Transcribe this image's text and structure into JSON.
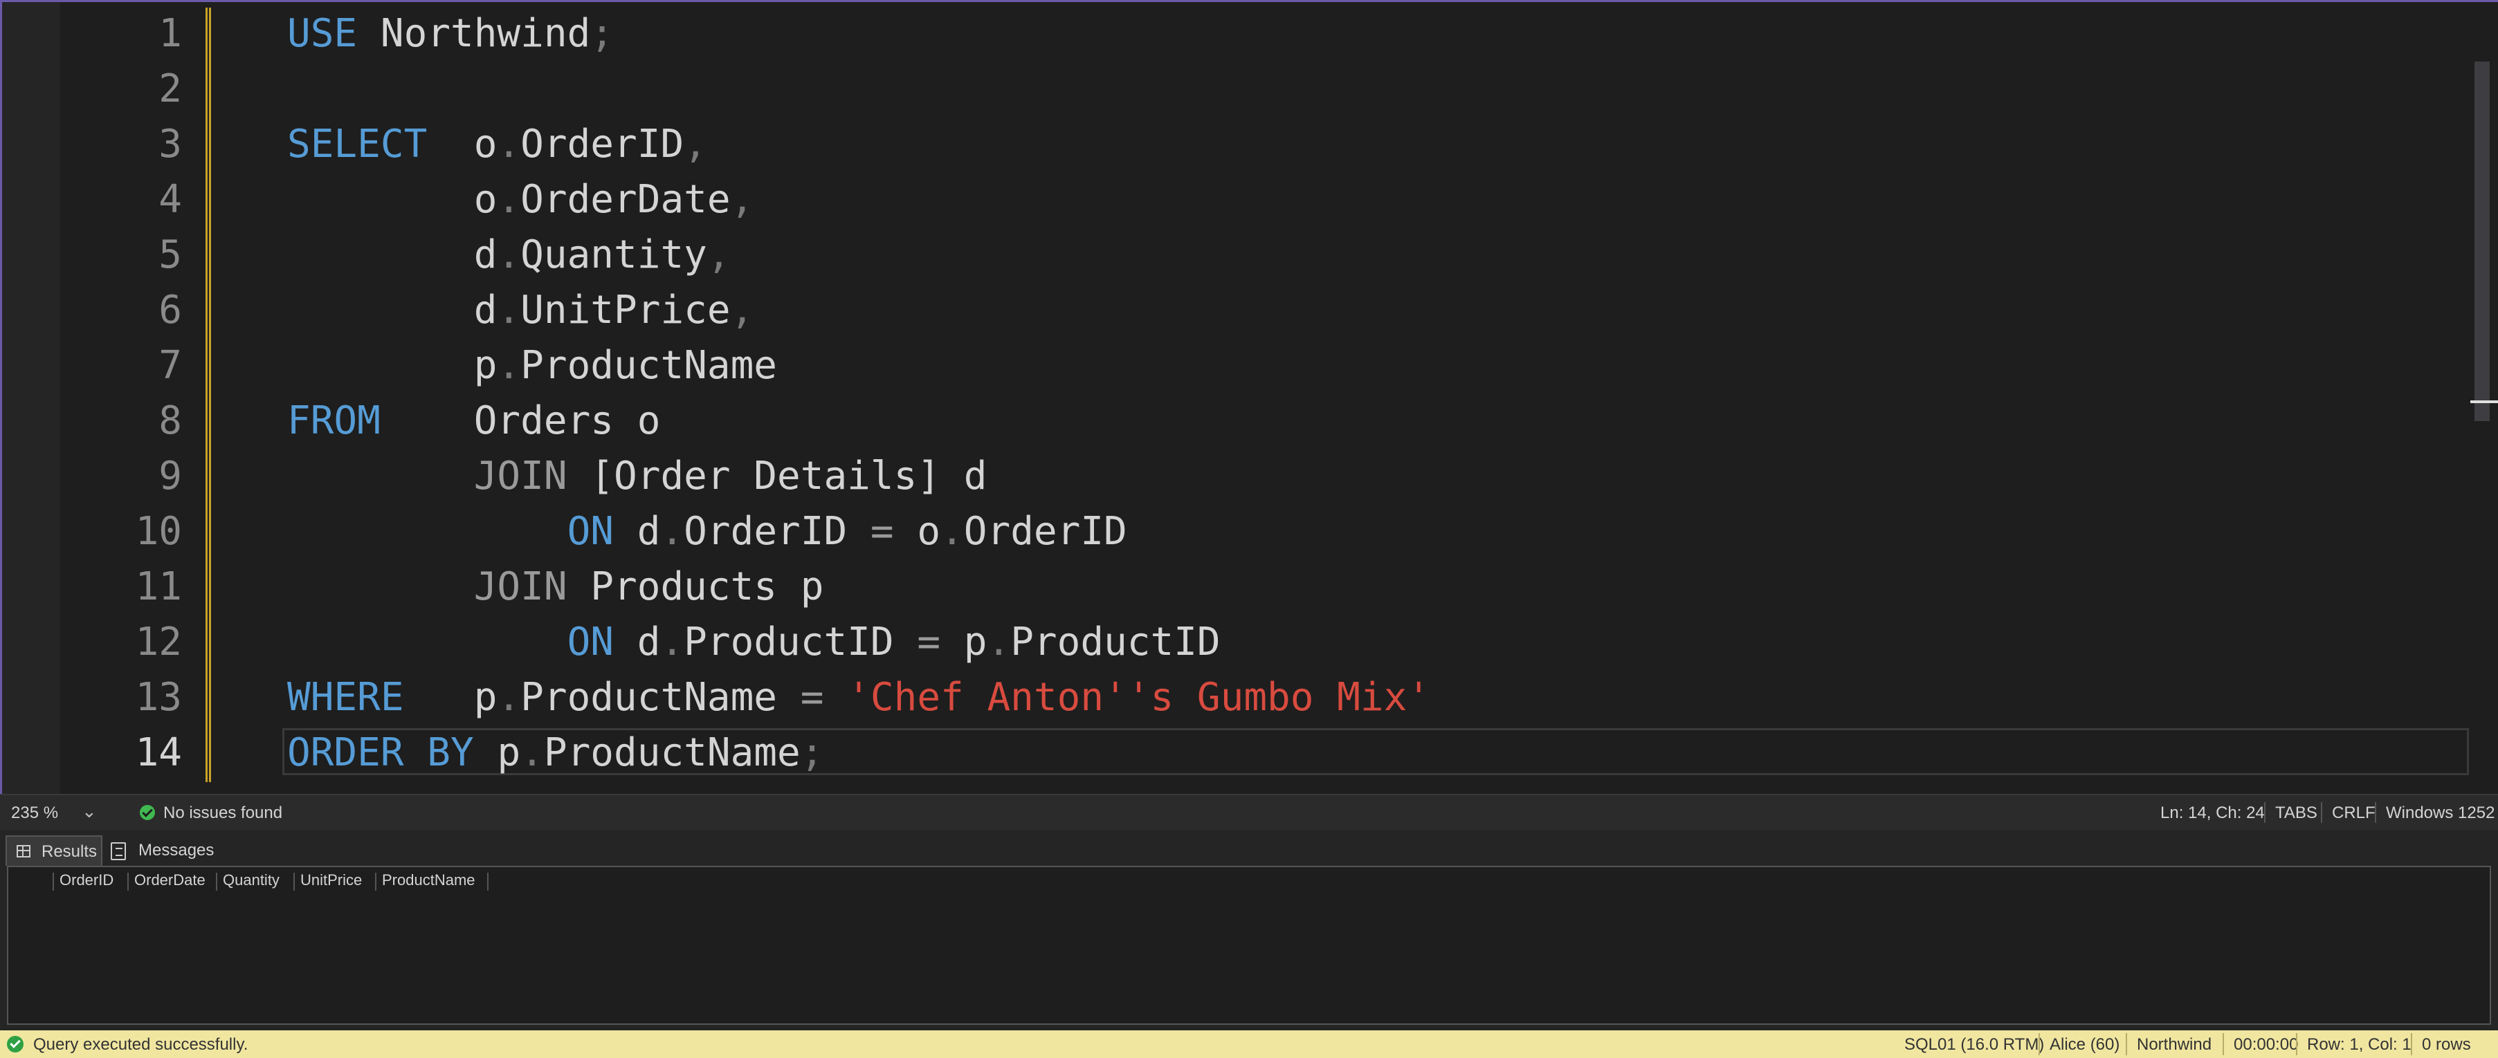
{
  "editor": {
    "lines": [
      {
        "n": "1",
        "tokens": [
          {
            "t": "USE ",
            "c": "kw"
          },
          {
            "t": "Northwind",
            "c": ""
          },
          {
            "t": ";",
            "c": "pn"
          }
        ]
      },
      {
        "n": "2",
        "tokens": []
      },
      {
        "n": "3",
        "tokens": [
          {
            "t": "SELECT  ",
            "c": "kw"
          },
          {
            "t": "o",
            "c": ""
          },
          {
            "t": ".",
            "c": "pn"
          },
          {
            "t": "OrderID",
            "c": ""
          },
          {
            "t": ",",
            "c": "pn"
          }
        ]
      },
      {
        "n": "4",
        "tokens": [
          {
            "t": "        o",
            "c": ""
          },
          {
            "t": ".",
            "c": "pn"
          },
          {
            "t": "OrderDate",
            "c": ""
          },
          {
            "t": ",",
            "c": "pn"
          }
        ]
      },
      {
        "n": "5",
        "tokens": [
          {
            "t": "        d",
            "c": ""
          },
          {
            "t": ".",
            "c": "pn"
          },
          {
            "t": "Quantity",
            "c": ""
          },
          {
            "t": ",",
            "c": "pn"
          }
        ]
      },
      {
        "n": "6",
        "tokens": [
          {
            "t": "        d",
            "c": ""
          },
          {
            "t": ".",
            "c": "pn"
          },
          {
            "t": "UnitPrice",
            "c": ""
          },
          {
            "t": ",",
            "c": "pn"
          }
        ]
      },
      {
        "n": "7",
        "tokens": [
          {
            "t": "        p",
            "c": ""
          },
          {
            "t": ".",
            "c": "pn"
          },
          {
            "t": "ProductName",
            "c": ""
          }
        ]
      },
      {
        "n": "8",
        "tokens": [
          {
            "t": "FROM    ",
            "c": "kw"
          },
          {
            "t": "Orders o",
            "c": ""
          }
        ]
      },
      {
        "n": "9",
        "tokens": [
          {
            "t": "        ",
            "c": ""
          },
          {
            "t": "JOIN ",
            "c": "gr"
          },
          {
            "t": "[Order Details] d",
            "c": ""
          }
        ]
      },
      {
        "n": "10",
        "tokens": [
          {
            "t": "            ",
            "c": ""
          },
          {
            "t": "ON ",
            "c": "kw"
          },
          {
            "t": "d",
            "c": ""
          },
          {
            "t": ".",
            "c": "pn"
          },
          {
            "t": "OrderID ",
            "c": ""
          },
          {
            "t": "= ",
            "c": "gr"
          },
          {
            "t": "o",
            "c": ""
          },
          {
            "t": ".",
            "c": "pn"
          },
          {
            "t": "OrderID",
            "c": ""
          }
        ]
      },
      {
        "n": "11",
        "tokens": [
          {
            "t": "        ",
            "c": ""
          },
          {
            "t": "JOIN ",
            "c": "gr"
          },
          {
            "t": "Products p",
            "c": ""
          }
        ]
      },
      {
        "n": "12",
        "tokens": [
          {
            "t": "            ",
            "c": ""
          },
          {
            "t": "ON ",
            "c": "kw"
          },
          {
            "t": "d",
            "c": ""
          },
          {
            "t": ".",
            "c": "pn"
          },
          {
            "t": "ProductID ",
            "c": ""
          },
          {
            "t": "= ",
            "c": "gr"
          },
          {
            "t": "p",
            "c": ""
          },
          {
            "t": ".",
            "c": "pn"
          },
          {
            "t": "ProductID",
            "c": ""
          }
        ]
      },
      {
        "n": "13",
        "tokens": [
          {
            "t": "WHERE   ",
            "c": "kw"
          },
          {
            "t": "p",
            "c": ""
          },
          {
            "t": ".",
            "c": "pn"
          },
          {
            "t": "ProductName ",
            "c": ""
          },
          {
            "t": "= ",
            "c": "gr"
          },
          {
            "t": "'Chef Anton''s Gumbo Mix'",
            "c": "str"
          }
        ]
      },
      {
        "n": "14",
        "tokens": [
          {
            "t": "ORDER BY ",
            "c": "kw"
          },
          {
            "t": "p",
            "c": ""
          },
          {
            "t": ".",
            "c": "pn"
          },
          {
            "t": "ProductName",
            "c": ""
          },
          {
            "t": ";",
            "c": "pn"
          }
        ]
      }
    ]
  },
  "status": {
    "zoom": "235 %",
    "issues": "No issues found",
    "position": "Ln: 14, Ch: 24",
    "indent": "TABS",
    "eol": "CRLF",
    "encoding": "Windows 1252"
  },
  "results": {
    "tabs": {
      "results": "Results",
      "messages": "Messages"
    },
    "columns": [
      "OrderID",
      "OrderDate",
      "Quantity",
      "UnitPrice",
      "ProductName"
    ]
  },
  "bottom": {
    "message": "Query executed successfully.",
    "server": "SQL01 (16.0 RTM)",
    "user": "Alice (60)",
    "database": "Northwind",
    "elapsed": "00:00:00",
    "cursor": "Row: 1, Col: 1",
    "rows": "0 rows"
  },
  "colors": {
    "keyword": "#569cd6",
    "string": "#d84b3f",
    "status_bar": "#f0e6a0",
    "change_marker": "#c9a227"
  }
}
